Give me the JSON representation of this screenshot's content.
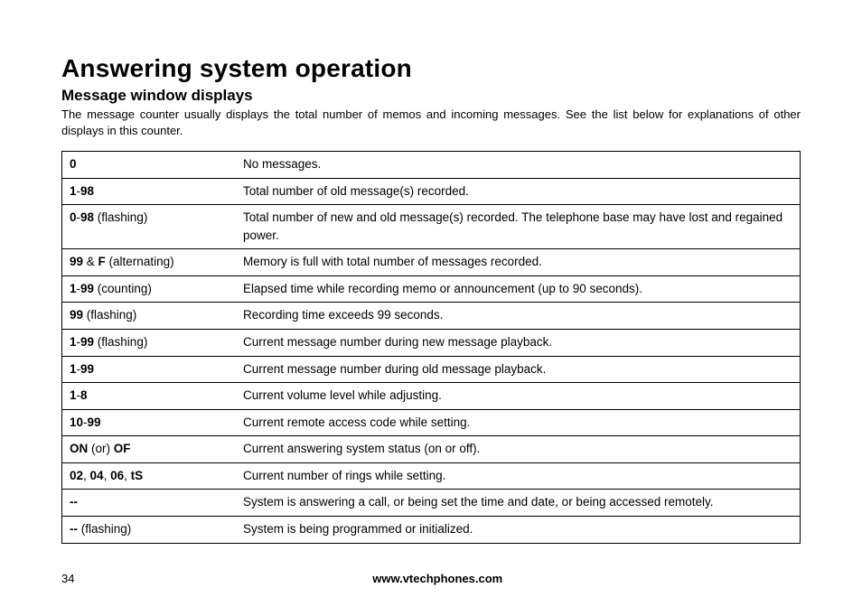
{
  "title": "Answering system operation",
  "subtitle": "Message window displays",
  "intro": "The message counter usually displays the total number of memos and incoming messages. See the list below for explanations of other displays in this counter.",
  "rows": [
    {
      "code_html": "<b>0</b>",
      "desc": "No messages."
    },
    {
      "code_html": "<b>1</b>-<b>98</b>",
      "desc": "Total number of old message(s) recorded."
    },
    {
      "code_html": "<b>0</b>-<b>98</b> (flashing)",
      "desc": "Total number of new and old message(s) recorded. The telephone base may have lost and regained power."
    },
    {
      "code_html": "<b>99</b> &amp; <b>F</b> (alternating)",
      "desc": "Memory is full with total number of messages recorded."
    },
    {
      "code_html": "<b>1</b>-<b>99</b> (counting)",
      "desc": "Elapsed time while recording memo or announcement (up to 90 seconds)."
    },
    {
      "code_html": "<b>99</b> (flashing)",
      "desc": "Recording time exceeds 99 seconds."
    },
    {
      "code_html": "<b>1</b>-<b>99</b> (flashing)",
      "desc": "Current message number during new message playback."
    },
    {
      "code_html": "<b>1</b>-<b>99</b>",
      "desc": "Current message number during old message playback."
    },
    {
      "code_html": "<b>1</b>-<b>8</b>",
      "desc": "Current volume level while adjusting."
    },
    {
      "code_html": "<b>10</b>-<b>99</b>",
      "desc": "Current remote access code while setting."
    },
    {
      "code_html": "<b>ON</b> (or) <b>OF</b>",
      "desc": "Current answering system status (on or off)."
    },
    {
      "code_html": "<b>02</b>, <b>04</b>, <b>06</b>, <b>tS</b>",
      "desc": "Current number of rings while setting."
    },
    {
      "code_html": "<b>--</b>",
      "desc": "System is answering a call, or being set the time and date, or being accessed remotely.",
      "justify": true
    },
    {
      "code_html": "<b>--</b> (flashing)",
      "desc": "System is being programmed or initialized."
    }
  ],
  "footer": {
    "page_number": "34",
    "site": "www.vtechphones.com"
  }
}
